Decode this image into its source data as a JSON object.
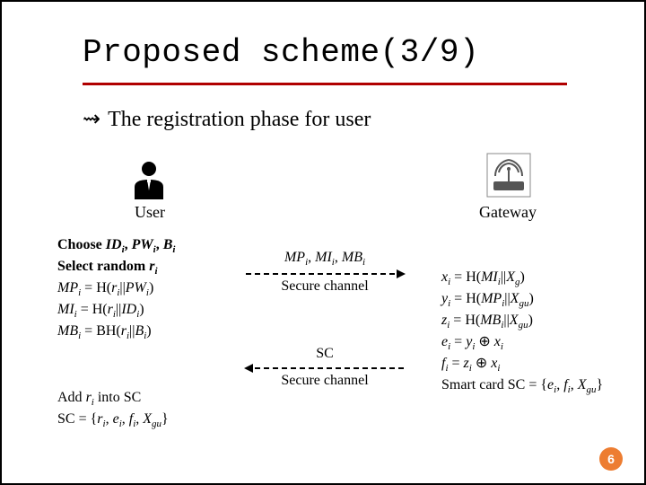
{
  "title": "Proposed scheme(3/9)",
  "bullet_marker": "⇝",
  "bullet_text": "The registration phase for user",
  "actors": {
    "user": "User",
    "gateway": "Gateway"
  },
  "user_block_html": "<span class='b'>Choose <span class='it'>ID</span><span class='sub'>i</span>, <span class='it'>PW</span><span class='sub'>i</span>, <span class='it'>B</span><span class='sub'>i</span></span><br><span class='b'>Select random <span class='it'>r</span><span class='sub'>i</span></span><br><span class='it'>MP</span><span class='sub'>i</span> = H(<span class='it'>r</span><span class='sub'>i</span>||<span class='it'>PW</span><span class='sub'>i</span>)<br><span class='it'>MI</span><span class='sub'>i</span> = H(<span class='it'>r</span><span class='sub'>i</span>||<span class='it'>ID</span><span class='sub'>i</span>)<br><span class='it'>MB</span><span class='sub'>i</span> = BH(<span class='it'>r</span><span class='sub'>i</span>||<span class='it'>B</span><span class='sub'>i</span>)",
  "user_block2_html": "Add <span class='it'>r</span><span class='sub'>i</span> into SC<br>SC = {<span class='it'>r</span><span class='sub'>i</span>, <span class='it'>e</span><span class='sub'>i</span>, <span class='it'>f</span><span class='sub'>i</span>, <span class='it'>X</span><span class='sub'>gu</span>}",
  "gw_block_html": "<span class='it'>x</span><span class='sub'>i</span> = H(<span class='it'>MI</span><span class='sub'>i</span>||<span class='it'>X</span><span class='sub'>g</span>)<br><span class='it'>y</span><span class='sub'>i</span> = H(<span class='it'>MP</span><span class='sub'>i</span>||<span class='it'>X</span><span class='sub'>gu</span>)<br><span class='it'>z</span><span class='sub'>i</span> = H(<span class='it'>MB</span><span class='sub'>i</span>||<span class='it'>X</span><span class='sub'>gu</span>)<br><span class='it'>e</span><span class='sub'>i</span> = <span class='it'>y</span><span class='sub'>i</span> ⊕ <span class='it'>x</span><span class='sub'>i</span><br><span class='it'>f</span><span class='sub'>i</span> = <span class='it'>z</span><span class='sub'>i</span> ⊕ <span class='it'>x</span><span class='sub'>i</span><br>Smart card SC = {<span class='it'>e</span><span class='sub'>i</span>, <span class='it'>f</span><span class='sub'>i</span>, <span class='it'>X</span><span class='sub'>gu</span>}",
  "arrow1": {
    "msg_html": "<span class='it'>MP</span><span class='sub'>i</span>, <span class='it'>MI</span><span class='sub'>i</span>, <span class='it'>MB</span><span class='sub'>i</span>",
    "note": "Secure channel"
  },
  "arrow2": {
    "msg_html": "SC",
    "note": "Secure channel"
  },
  "page_number": "6"
}
